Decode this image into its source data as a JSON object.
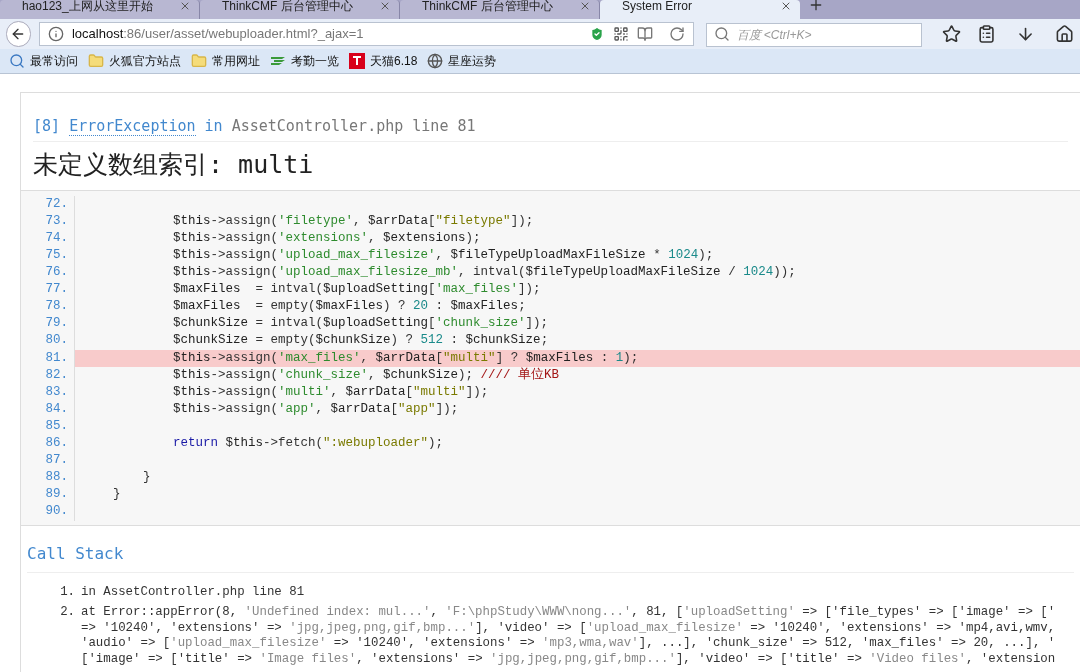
{
  "tabs": [
    {
      "title": "hao123_上网从这里开始",
      "selected": false
    },
    {
      "title": "ThinkCMF 后台管理中心",
      "selected": false
    },
    {
      "title": "ThinkCMF 后台管理中心",
      "selected": false
    },
    {
      "title": "System Error",
      "selected": true
    }
  ],
  "address": {
    "host": "localhost",
    "rest": ":86/user/asset/webuploader.html?_ajax=1"
  },
  "search": {
    "placeholder": "百度 <Ctrl+K>"
  },
  "bookmarks": [
    {
      "kind": "search",
      "label": "最常访问"
    },
    {
      "kind": "folder",
      "label": "火狐官方站点"
    },
    {
      "kind": "folder",
      "label": "常用网址"
    },
    {
      "kind": "stripes",
      "label": "考勤一览"
    },
    {
      "kind": "tmall",
      "label": "天猫6.18"
    },
    {
      "kind": "globe",
      "label": "星座运势"
    }
  ],
  "error": {
    "code": "[8]",
    "type": "ErrorException",
    "in": "in",
    "file": "AssetController.php line 81",
    "message": "未定义数组索引: multi"
  },
  "code_lines": [
    {
      "number": "72.",
      "highlighted": false
    },
    {
      "number": "73.",
      "text": "            $this->assign('filetype', $arrData[\"filetype\"]);",
      "highlighted": false
    },
    {
      "number": "74.",
      "text": "            $this->assign('extensions', $extensions);",
      "highlighted": false
    },
    {
      "number": "75.",
      "text": "            $this->assign('upload_max_filesize', $fileTypeUploadMaxFileSize * 1024);",
      "highlighted": false
    },
    {
      "number": "76.",
      "text": "            $this->assign('upload_max_filesize_mb', intval($fileTypeUploadMaxFileSize / 1024));",
      "highlighted": false
    },
    {
      "number": "77.",
      "text": "            $maxFiles  = intval($uploadSetting['max_files']);",
      "highlighted": false
    },
    {
      "number": "78.",
      "text": "            $maxFiles  = empty($maxFiles) ? 20 : $maxFiles;",
      "highlighted": false
    },
    {
      "number": "79.",
      "text": "            $chunkSize = intval($uploadSetting['chunk_size']);",
      "highlighted": false
    },
    {
      "number": "80.",
      "text": "            $chunkSize = empty($chunkSize) ? 512 : $chunkSize;",
      "highlighted": false
    },
    {
      "number": "81.",
      "text": "            $this->assign('max_files', $arrData[\"multi\"] ? $maxFiles : 1);",
      "highlighted": true
    },
    {
      "number": "82.",
      "text": "            $this->assign('chunk_size', $chunkSize); //// 单位KB",
      "highlighted": false
    },
    {
      "number": "83.",
      "text": "            $this->assign('multi', $arrData[\"multi\"]);",
      "highlighted": false
    },
    {
      "number": "84.",
      "text": "            $this->assign('app', $arrData[\"app\"]);",
      "highlighted": false
    },
    {
      "number": "85.",
      "highlighted": false
    },
    {
      "number": "86.",
      "text": "            return $this->fetch(\":webuploader\");",
      "highlighted": false
    },
    {
      "number": "87.",
      "highlighted": false
    },
    {
      "number": "88.",
      "text": "        }",
      "highlighted": false
    },
    {
      "number": "89.",
      "text": "    }",
      "highlighted": false
    },
    {
      "number": "90.",
      "highlighted": false
    }
  ],
  "call_stack": {
    "title": "Call Stack",
    "items": [
      {
        "number": "1.",
        "lines": [
          "in AssetController.php line 81"
        ]
      },
      {
        "number": "2.",
        "lines": [
          "at Error::appError(8, 'Undefined index: mul...', 'F:\\phpStudy\\WWW\\nong...', 81, ['uploadSetting' => ['file_types' => ['image' => ['",
          "=> '10240', 'extensions' => 'jpg,jpeg,png,gif,bmp...'], 'video' => ['upload_max_filesize' => '10240', 'extensions' => 'mp4,avi,wmv,",
          "'audio' => ['upload_max_filesize' => '10240', 'extensions' => 'mp3,wma,wav'], ...], 'chunk_size' => 512, 'max_files' => 20, ...], '",
          "['image' => ['title' => 'Image files', 'extensions' => 'jpg,jpeg,png,gif,bmp...'], 'video' => ['title' => 'Video files', 'extension"
        ]
      }
    ]
  }
}
